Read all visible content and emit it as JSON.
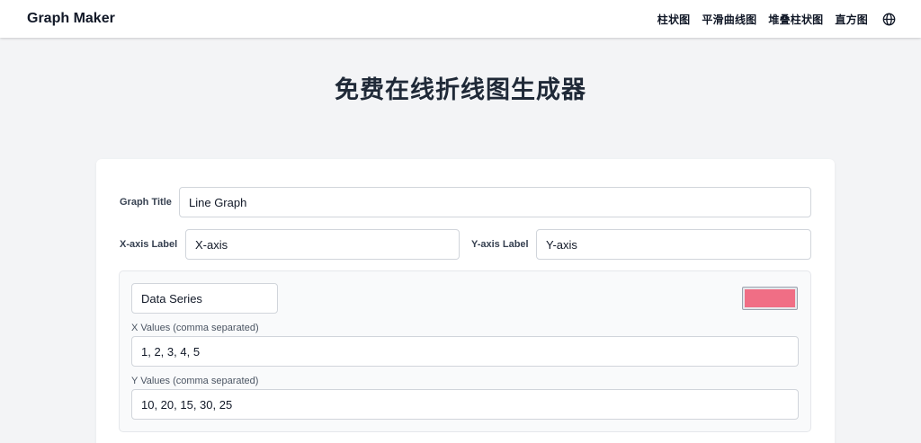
{
  "navbar": {
    "brand": "Graph Maker",
    "links": [
      "柱状图",
      "平滑曲线图",
      "堆叠柱状图",
      "直方图"
    ],
    "language_icon": "globe-icon"
  },
  "page": {
    "title": "免费在线折线图生成器"
  },
  "form": {
    "graph_title_label": "Graph Title",
    "graph_title_value": "Line Graph",
    "x_axis_label": "X-axis Label",
    "x_axis_value": "X-axis",
    "y_axis_label": "Y-axis Label",
    "y_axis_value": "Y-axis",
    "series": {
      "name_value": "Data Series",
      "color": "#f06e85",
      "x_values_label": "X Values (comma separated)",
      "x_values_value": "1, 2, 3, 4, 5",
      "y_values_label": "Y Values (comma separated)",
      "y_values_value": "10, 20, 15, 30, 25"
    }
  }
}
